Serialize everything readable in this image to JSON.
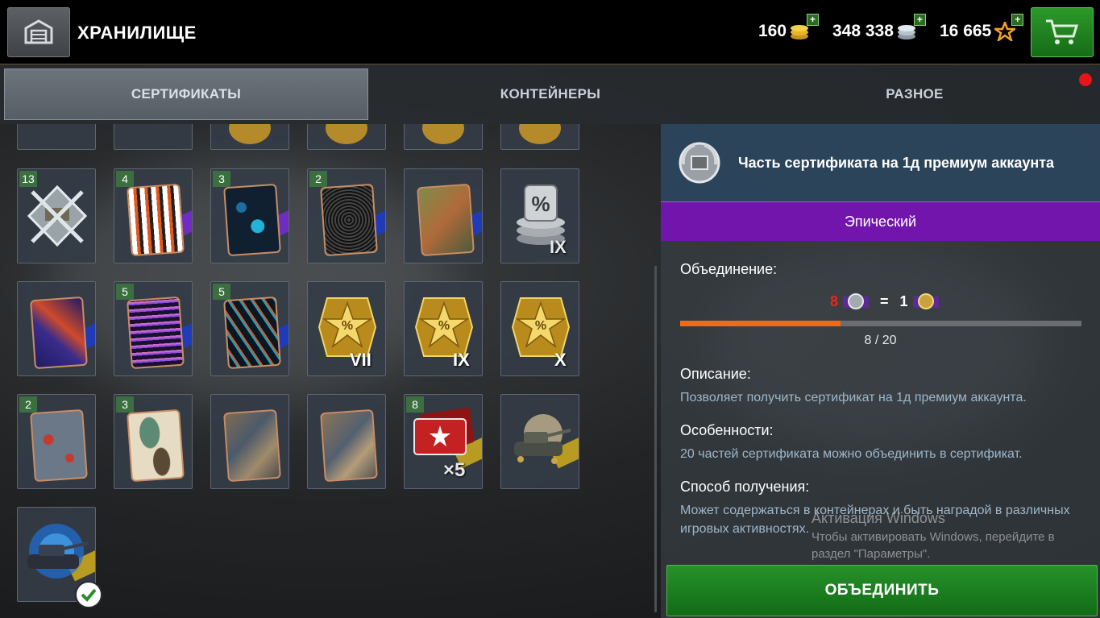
{
  "header": {
    "title": "ХРАНИЛИЩЕ",
    "gold": "160",
    "credits": "348 338",
    "free_xp": "16 665",
    "plus": "+"
  },
  "tabs": [
    {
      "label": "СЕРТИФИКАТЫ",
      "active": true
    },
    {
      "label": "КОНТЕЙНЕРЫ",
      "active": false
    },
    {
      "label": "РАЗНОЕ",
      "active": false
    }
  ],
  "grid": {
    "counts": [
      "13",
      "4",
      "3",
      "2",
      "5",
      "5",
      "2",
      "3",
      "8"
    ],
    "tier_labels": [
      "IX",
      "VII",
      "IX",
      "X"
    ],
    "multiplier": "×5"
  },
  "detail": {
    "title": "Часть сертификата на 1д премиум аккаунта",
    "rarity": "Эпический",
    "rarity_color": "#7215ad",
    "merge_label": "Объединение:",
    "merge_need": "8",
    "merge_eq": "=",
    "merge_result": "1",
    "progress_text": "8 / 20",
    "progress_fraction": 0.4,
    "description_label": "Описание:",
    "description": "Позволяет получить сертификат на 1д премиум аккаунта.",
    "features_label": "Особенности:",
    "features": "20 частей сертификата можно объединить в сертификат.",
    "obtain_label": "Способ получения:",
    "obtain": "Может содержаться в контейнерах и быть наградой в различных игровых активностях.",
    "button": "ОБЪЕДИНИТЬ"
  },
  "watermark": {
    "line1": "Активация Windows",
    "line2": "Чтобы активировать Windows, перейдите в раздел \"Параметры\"."
  }
}
